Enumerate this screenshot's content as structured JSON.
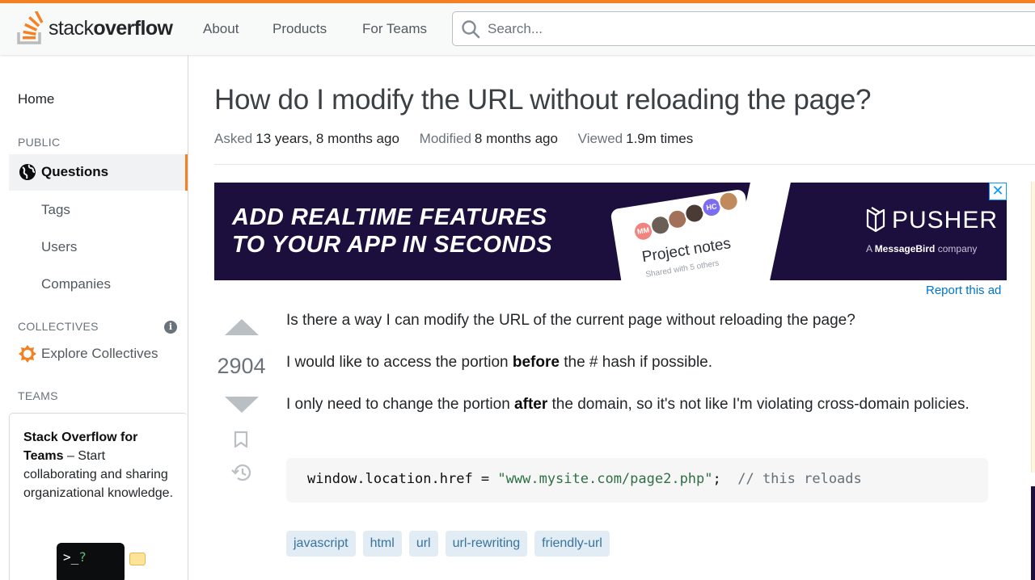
{
  "header": {
    "logo": {
      "text_light": "stack",
      "text_bold": "overflow"
    },
    "nav": [
      "About",
      "Products",
      "For Teams"
    ],
    "search": {
      "placeholder": "Search...",
      "value": ""
    },
    "accent_color": "#f48225"
  },
  "sidebar": {
    "home": "Home",
    "public_label": "PUBLIC",
    "questions": "Questions",
    "items": [
      "Tags",
      "Users",
      "Companies"
    ],
    "collectives_label": "COLLECTIVES",
    "explore": "Explore Collectives",
    "teams_label": "TEAMS",
    "teams_box": {
      "bold": "Stack Overflow for Teams",
      "text": " – Start collaborating and sharing organizational knowledge.",
      "terminal": {
        "prompt": ">_",
        "cursor": "?"
      }
    }
  },
  "question": {
    "title": "How do I modify the URL without reloading the page?",
    "meta": [
      {
        "key": "Asked",
        "value": "13 years, 8 months ago"
      },
      {
        "key": "Modified",
        "value": "8 months ago"
      },
      {
        "key": "Viewed",
        "value": "1.9m times"
      }
    ],
    "votes": "2904",
    "body": {
      "p1": "Is there a way I can modify the URL of the current page without reloading the page?",
      "p2_pre": "I would like to access the portion ",
      "p2_bold": "before",
      "p2_post": " the # hash if possible.",
      "p3_pre": "I only need to change the portion ",
      "p3_bold": "after",
      "p3_post": " the domain, so it's not like I'm violating cross-domain policies."
    },
    "code": {
      "pre": "window.location.href = ",
      "string": "\"www.mysite.com/page2.php\"",
      "mid": ";  ",
      "comment": "// this reloads"
    },
    "tags": [
      "javascript",
      "html",
      "url",
      "url-rewriting",
      "friendly-url"
    ]
  },
  "ad": {
    "headline_line1": "ADD REALTIME FEATURES",
    "headline_line2": "TO YOUR APP IN SECONDS",
    "card_title": "Project notes",
    "card_sub": "Shared with 5 others",
    "avatars": [
      "MM",
      "HC"
    ],
    "brand": "PUSHER",
    "brand_sub_pre": "A ",
    "brand_sub_bold": "MessageBird",
    "brand_sub_post": " company",
    "close": "✕",
    "report": "Report this ad"
  }
}
